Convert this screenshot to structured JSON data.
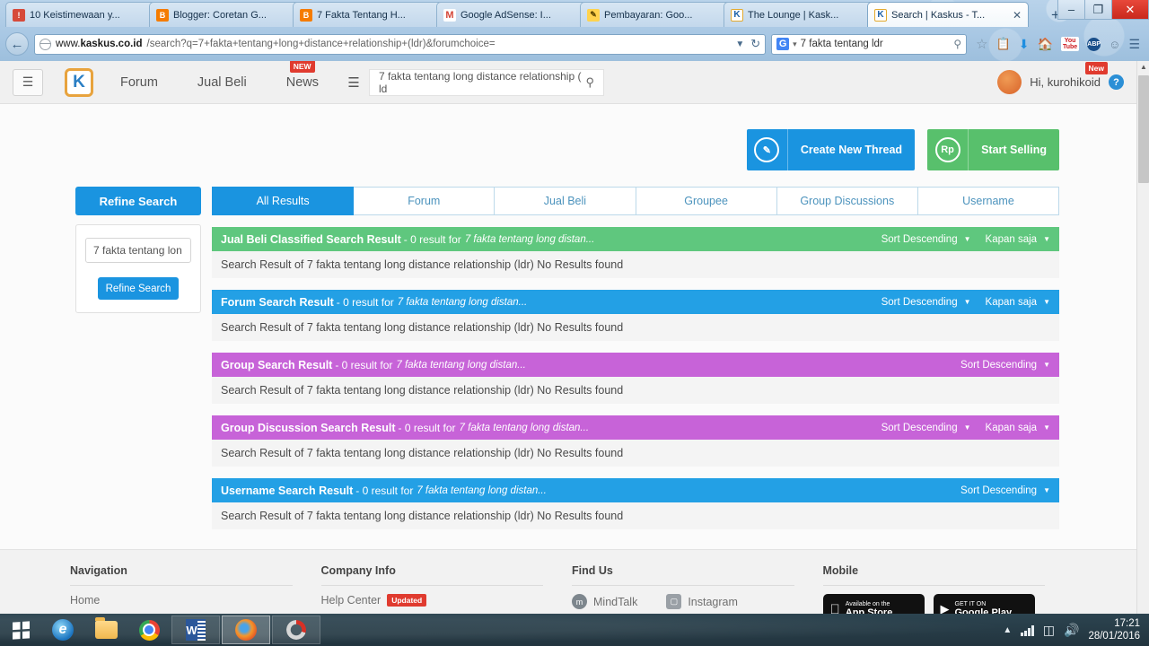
{
  "browser": {
    "tabs": [
      {
        "title": "10 Keistimewaan y...",
        "favicon": "bookmark-icon",
        "active": false
      },
      {
        "title": "Blogger: Coretan G...",
        "favicon": "blogger-icon",
        "active": false
      },
      {
        "title": "7 Fakta Tentang H...",
        "favicon": "blogger-icon",
        "active": false
      },
      {
        "title": "Google AdSense: I...",
        "favicon": "gmail-icon",
        "active": false
      },
      {
        "title": "Pembayaran: Goo...",
        "favicon": "pencil-icon",
        "active": false
      },
      {
        "title": "The Lounge | Kask...",
        "favicon": "kaskus-icon",
        "active": false
      },
      {
        "title": "Search | Kaskus - T...",
        "favicon": "kaskus-icon",
        "active": true
      }
    ],
    "new_tab_label": "+",
    "window_controls": {
      "minimize": "–",
      "restore": "❐",
      "close": "✕"
    },
    "url": {
      "host_prefix": "www.",
      "host_bold": "kaskus.co.id",
      "path": "/search?q=7+fakta+tentang+long+distance+relationship+(ldr)&forumchoice="
    },
    "url_dropdown": "▼",
    "reload": "↻",
    "search_engine": "G",
    "search_value": "7 fakta tentang ldr",
    "search_dropdown": "▾",
    "nav_icons": [
      "star-icon",
      "reading-list-icon",
      "download-icon",
      "home-icon",
      "youtube-icon",
      "adblock-icon",
      "smiley-icon",
      "menu-icon"
    ],
    "back_arrow": "←"
  },
  "site_header": {
    "menu_icon": "hamburger-icon",
    "logo_text": "K",
    "nav": [
      {
        "label": "Forum",
        "badge": ""
      },
      {
        "label": "Jual Beli",
        "badge": ""
      },
      {
        "label": "News",
        "badge": "NEW"
      }
    ],
    "category_icon": "hamburger-icon",
    "search_value": "7 fakta tentang long distance relationship ( ld",
    "search_icon": "search-icon",
    "greeting": "Hi, kurohikoid",
    "user_badge": "New",
    "help_label": "?"
  },
  "actions": [
    {
      "icon": "pencil-icon",
      "icon_glyph": "✎",
      "label": "Create New Thread",
      "color": "#1a94e0"
    },
    {
      "icon": "rupiah-icon",
      "icon_glyph": "Rp",
      "label": "Start Selling",
      "color": "#58c06c"
    }
  ],
  "sidebar": {
    "refine_header": "Refine Search",
    "input_value": "7 fakta tentang lon",
    "refine_button": "Refine Search"
  },
  "tabs": [
    {
      "label": "All Results",
      "active": true
    },
    {
      "label": "Forum",
      "active": false
    },
    {
      "label": "Jual Beli",
      "active": false
    },
    {
      "label": "Groupee",
      "active": false
    },
    {
      "label": "Group Discussions",
      "active": false
    },
    {
      "label": "Username",
      "active": false
    }
  ],
  "results": [
    {
      "title": "Jual Beli Classified Search Result",
      "count_text": "- 0 result for",
      "query": "7 fakta tentang long distan...",
      "sort_label": "Sort Descending",
      "time_label": "Kapan saja",
      "body": "Search Result of 7 fakta tentang long distance relationship (ldr) No Results found",
      "color": "#5fc77e"
    },
    {
      "title": "Forum Search Result",
      "count_text": "- 0 result for",
      "query": "7 fakta tentang long distan...",
      "sort_label": "Sort Descending",
      "time_label": "Kapan saja",
      "body": "Search Result of 7 fakta tentang long distance relationship (ldr) No Results found",
      "color": "#23a0e5"
    },
    {
      "title": "Group Search Result",
      "count_text": "- 0 result for",
      "query": "7 fakta tentang long distan...",
      "sort_label": "Sort Descending",
      "time_label": "",
      "body": "Search Result of 7 fakta tentang long distance relationship (ldr) No Results found",
      "color": "#c763d8"
    },
    {
      "title": "Group Discussion Search Result",
      "count_text": "- 0 result for",
      "query": "7 fakta tentang long distan...",
      "sort_label": "Sort Descending",
      "time_label": "Kapan saja",
      "body": "Search Result of 7 fakta tentang long distance relationship (ldr) No Results found",
      "color": "#c763d8"
    },
    {
      "title": "Username Search Result",
      "count_text": "- 0 result for",
      "query": "7 fakta tentang long distan...",
      "sort_label": "Sort Descending",
      "time_label": "",
      "body": "Search Result of 7 fakta tentang long distance relationship (ldr) No Results found",
      "color": "#23a0e5"
    }
  ],
  "footer": {
    "columns": [
      {
        "heading": "Navigation",
        "items": [
          {
            "label": "Home",
            "badge": ""
          }
        ]
      },
      {
        "heading": "Company Info",
        "items": [
          {
            "label": "Help Center",
            "badge": "Updated"
          }
        ]
      },
      {
        "heading": "Find Us",
        "items": [
          {
            "label": "MindTalk",
            "badge": ""
          },
          {
            "label": "Instagram",
            "badge": ""
          }
        ]
      },
      {
        "heading": "Mobile",
        "items": []
      }
    ],
    "stores": [
      {
        "top": "Available on the",
        "name": "App Store"
      },
      {
        "top": "GET IT ON",
        "name": "Google Play"
      }
    ]
  },
  "taskbar": {
    "start_icon": "windows-icon",
    "pinned": [
      "internet-explorer-icon",
      "file-explorer-icon",
      "google-chrome-icon"
    ],
    "windows": [
      "microsoft-word-icon",
      "firefox-icon",
      "spinner-icon"
    ],
    "tray": [
      "show-hidden-icon",
      "network-icon",
      "battery-icon",
      "volume-icon"
    ],
    "time": "17:21",
    "date": "28/01/2016"
  }
}
